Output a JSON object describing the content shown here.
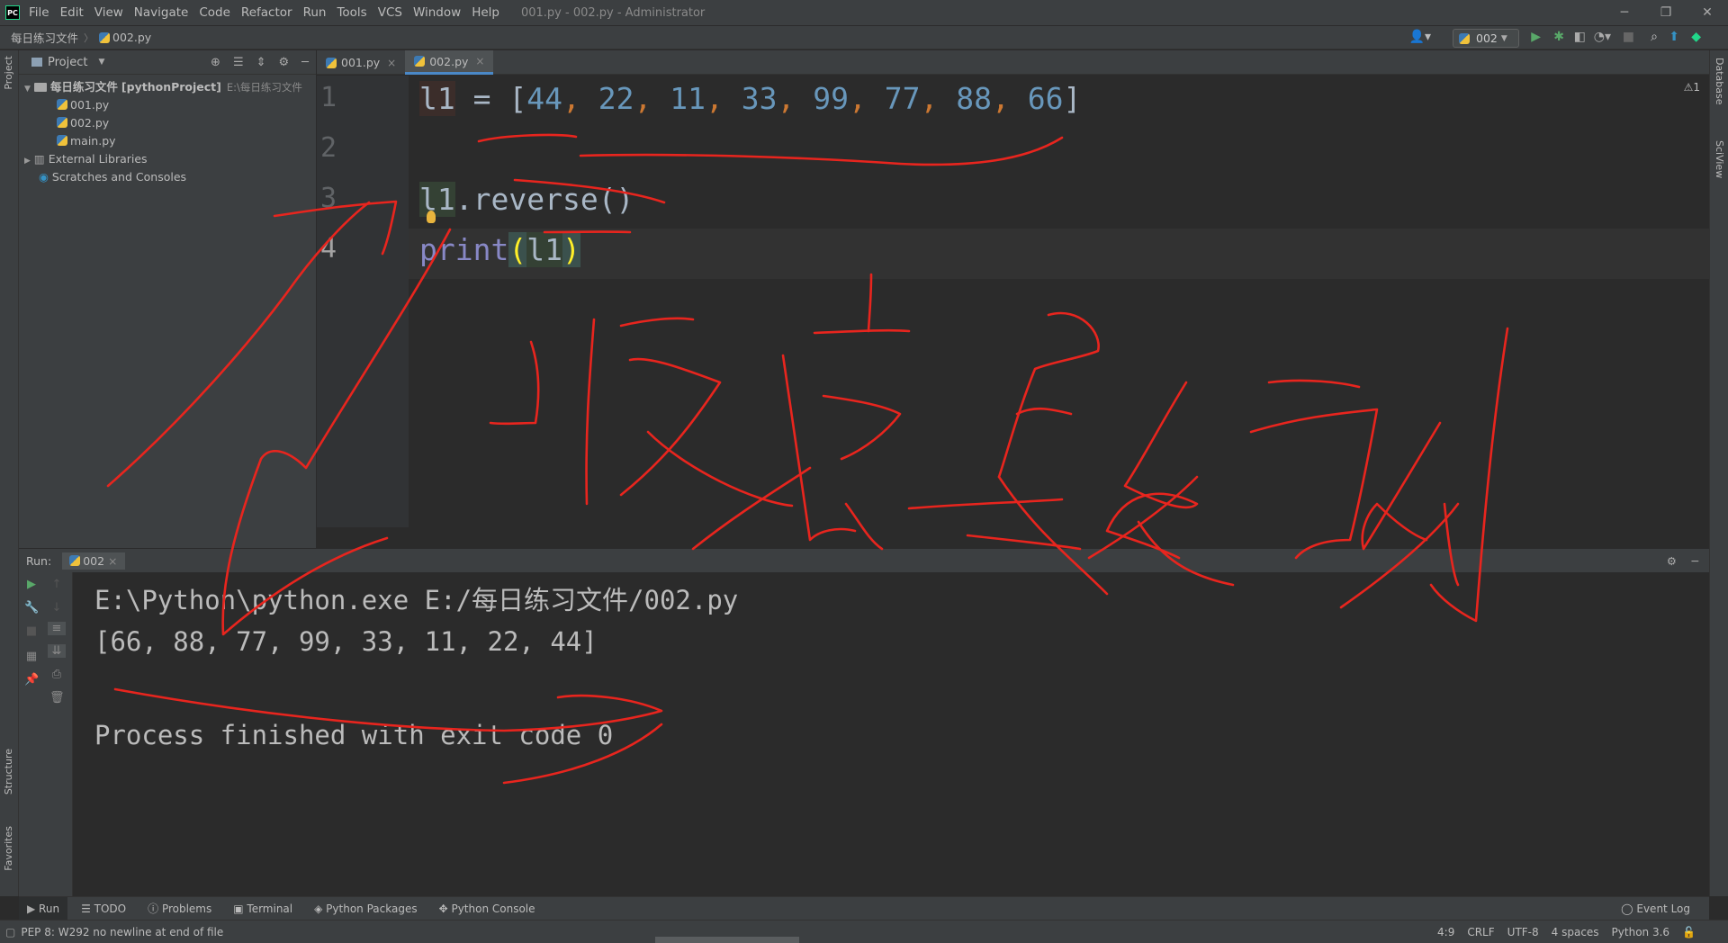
{
  "app": {
    "logo": "PC",
    "menu": [
      "File",
      "Edit",
      "View",
      "Navigate",
      "Code",
      "Refactor",
      "Run",
      "Tools",
      "VCS",
      "Window",
      "Help"
    ],
    "window_title": "001.py - 002.py - Administrator",
    "window_controls": [
      "─",
      "❐",
      "✕"
    ]
  },
  "navbar": {
    "breadcrumb": [
      "每日练习文件",
      "002.py"
    ],
    "run_config": "002"
  },
  "project": {
    "title": "Project",
    "tree": {
      "root_label": "每日练习文件",
      "root_project": "[pythonProject]",
      "root_path": "E:\\每日练习文件",
      "files": [
        "001.py",
        "002.py",
        "main.py"
      ],
      "external": "External Libraries",
      "scratches": "Scratches and Consoles"
    }
  },
  "left_strip": {
    "project": "Project",
    "structure": "Structure",
    "favorites": "Favorites"
  },
  "right_strip": {
    "database": "Database",
    "sciview": "SciView"
  },
  "tabs": [
    {
      "label": "001.py"
    },
    {
      "label": "002.py"
    }
  ],
  "editor": {
    "line_numbers": [
      "1",
      "2",
      "3",
      "4"
    ],
    "line1": {
      "var": "l1",
      "eq": " = ",
      "open": "[",
      "values": [
        "44",
        "22",
        "11",
        "33",
        "99",
        "77",
        "88",
        "66"
      ],
      "sep": ", ",
      "close": "]"
    },
    "line3": {
      "var": "l1",
      "rest": ".reverse()"
    },
    "line4": {
      "fn": "print",
      "open": "(",
      "arg": "l1",
      "close": ")"
    },
    "warnings": "⚠1"
  },
  "run_panel": {
    "label": "Run:",
    "tab": "002",
    "output": [
      "E:\\Python\\python.exe E:/每日练习文件/002.py",
      "[66, 88, 77, 99, 33, 11, 22, 44]",
      "",
      "Process finished with exit code 0"
    ]
  },
  "bottom_tabs": [
    "Run",
    "TODO",
    "Problems",
    "Terminal",
    "Python Packages",
    "Python Console"
  ],
  "event_log": "Event Log",
  "status": {
    "message": "PEP 8: W292 no newline at end of file",
    "position": "4:9",
    "line_sep": "CRLF",
    "encoding": "UTF-8",
    "indent": "4 spaces",
    "interpreter": "Python 3.6"
  },
  "colors": {
    "annotation_ink": "#e8251e",
    "number": "#6897bb",
    "operator": "#cc7832",
    "builtin": "#8888c6",
    "bracket_match": "#ffef28"
  }
}
